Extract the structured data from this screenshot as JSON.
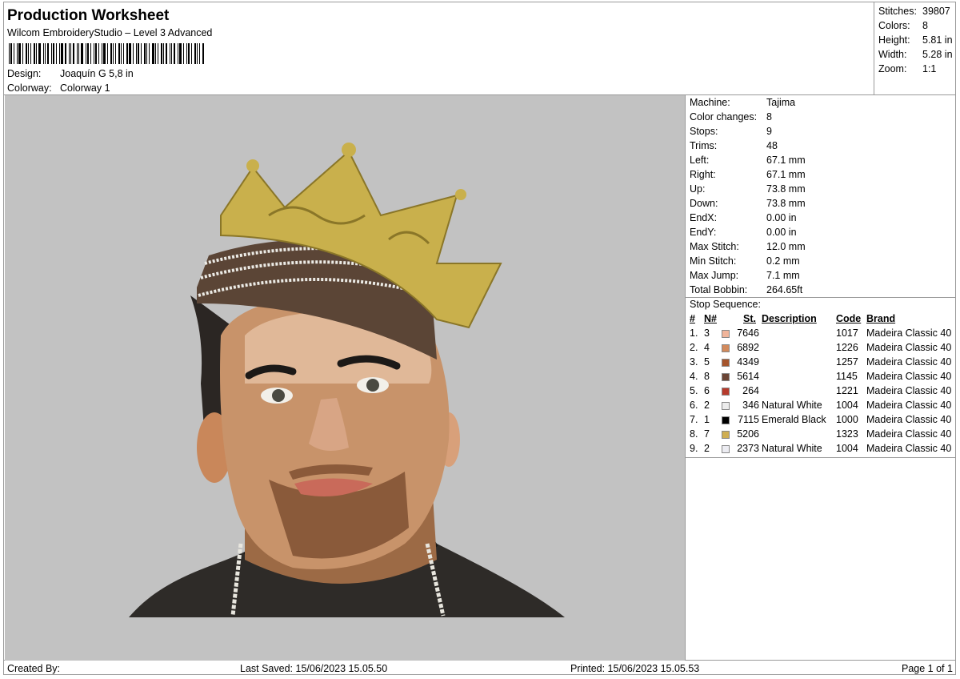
{
  "header": {
    "title": "Production Worksheet",
    "subtitle": "Wilcom EmbroideryStudio – Level 3 Advanced",
    "design_label": "Design:",
    "design_value": "Joaquín G 5,8 in",
    "colorway_label": "Colorway:",
    "colorway_value": "Colorway 1"
  },
  "stats": [
    {
      "label": "Stitches:",
      "value": "39807"
    },
    {
      "label": "Colors:",
      "value": "8"
    },
    {
      "label": "Height:",
      "value": "5.81 in"
    },
    {
      "label": "Width:",
      "value": "5.28 in"
    },
    {
      "label": "Zoom:",
      "value": "1:1"
    }
  ],
  "properties": [
    {
      "label": "Machine:",
      "value": "Tajima"
    },
    {
      "label": "Color changes:",
      "value": "8"
    },
    {
      "label": "Stops:",
      "value": "9"
    },
    {
      "label": "Trims:",
      "value": "48"
    },
    {
      "label": "Left:",
      "value": "67.1 mm"
    },
    {
      "label": "Right:",
      "value": "67.1 mm"
    },
    {
      "label": "Up:",
      "value": "73.8 mm"
    },
    {
      "label": "Down:",
      "value": "73.8 mm"
    },
    {
      "label": "EndX:",
      "value": "0.00 in"
    },
    {
      "label": "EndY:",
      "value": "0.00 in"
    },
    {
      "label": "Max Stitch:",
      "value": "12.0 mm"
    },
    {
      "label": "Min Stitch:",
      "value": "0.2 mm"
    },
    {
      "label": "Max Jump:",
      "value": "7.1 mm"
    },
    {
      "label": "Total Bobbin:",
      "value": "264.65ft"
    }
  ],
  "stop_sequence": {
    "title": "Stop Sequence:",
    "headers": {
      "num": "#",
      "n": "N#",
      "st": "St.",
      "description": "Description",
      "code": "Code",
      "brand": "Brand"
    },
    "rows": [
      {
        "num": "1.",
        "n": "3",
        "color": "#f0b49a",
        "st": "7646",
        "description": "",
        "code": "1017",
        "brand": "Madeira Classic 40"
      },
      {
        "num": "2.",
        "n": "4",
        "color": "#d28a5c",
        "st": "6892",
        "description": "",
        "code": "1226",
        "brand": "Madeira Classic 40"
      },
      {
        "num": "3.",
        "n": "5",
        "color": "#a5552c",
        "st": "4349",
        "description": "",
        "code": "1257",
        "brand": "Madeira Classic 40"
      },
      {
        "num": "4.",
        "n": "8",
        "color": "#6a4535",
        "st": "5614",
        "description": "",
        "code": "1145",
        "brand": "Madeira Classic 40"
      },
      {
        "num": "5.",
        "n": "6",
        "color": "#b63a2c",
        "st": "264",
        "description": "",
        "code": "1221",
        "brand": "Madeira Classic 40"
      },
      {
        "num": "6.",
        "n": "2",
        "color": "#ececec",
        "st": "346",
        "description": "Natural White",
        "code": "1004",
        "brand": "Madeira Classic 40"
      },
      {
        "num": "7.",
        "n": "1",
        "color": "#000000",
        "st": "7115",
        "description": "Emerald Black",
        "code": "1000",
        "brand": "Madeira Classic 40"
      },
      {
        "num": "8.",
        "n": "7",
        "color": "#cfae52",
        "st": "5206",
        "description": "",
        "code": "1323",
        "brand": "Madeira Classic 40"
      },
      {
        "num": "9.",
        "n": "2",
        "color": "#ececf2",
        "st": "2373",
        "description": "Natural White",
        "code": "1004",
        "brand": "Madeira Classic 40"
      }
    ]
  },
  "footer": {
    "created_by": "Created By:",
    "last_saved": "Last Saved: 15/06/2023 15.05.50",
    "printed": "Printed: 15/06/2023 15.05.53",
    "page": "Page 1 of 1"
  }
}
